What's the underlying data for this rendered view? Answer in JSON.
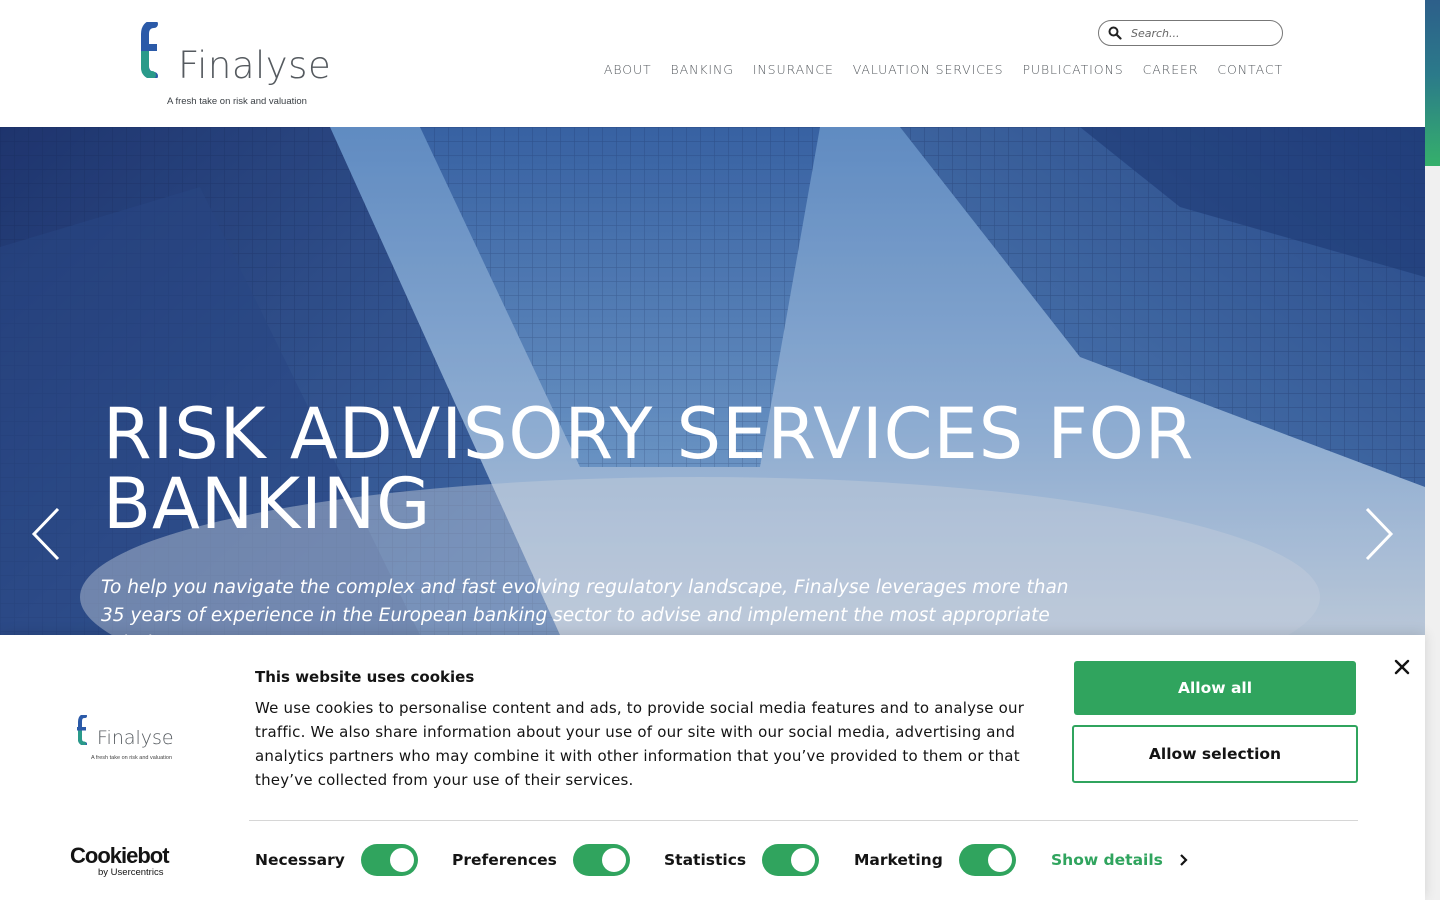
{
  "brand": {
    "name": "Finalyse",
    "tagline": "A fresh take on risk and valuation",
    "colors": {
      "blue": "#2b5aa8",
      "teal": "#2a8a8f",
      "green": "#35b06b",
      "text": "#555a5f"
    }
  },
  "search": {
    "placeholder": "Search..."
  },
  "nav": {
    "items": [
      "ABOUT",
      "BANKING",
      "INSURANCE",
      "VALUATION SERVICES",
      "PUBLICATIONS",
      "CAREER",
      "CONTACT"
    ]
  },
  "hero": {
    "title": "RISK ADVISORY SERVICES FOR BANKING",
    "subtitle": "To help you navigate the complex and fast evolving regulatory landscape, Finalyse leverages more than 35 years of experience in the European banking sector to advise and implement the most appropriate solutions",
    "prev_icon": "chevron-left-icon",
    "next_icon": "chevron-right-icon"
  },
  "cookie": {
    "title": "This website uses cookies",
    "text": "We use cookies to personalise content and ads, to provide social media features and to analyse our traffic. We also share information about your use of our site with our social media, advertising and analytics partners who may combine it with other information that you’ve provided to them or that they’ve collected from your use of their services.",
    "allow_all": "Allow all",
    "allow_selection": "Allow selection",
    "provider_name": "Cookiebot",
    "provider_by": "by Usercentrics",
    "accent": "#30a45e",
    "consents": [
      {
        "label": "Necessary",
        "checked": true
      },
      {
        "label": "Preferences",
        "checked": true
      },
      {
        "label": "Statistics",
        "checked": true
      },
      {
        "label": "Marketing",
        "checked": true
      }
    ],
    "show_details": "Show details"
  }
}
